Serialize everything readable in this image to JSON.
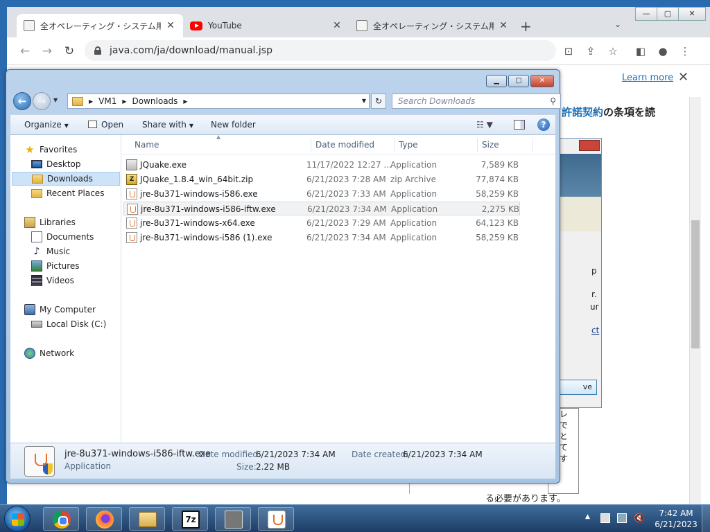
{
  "browser": {
    "tabs": [
      {
        "title": "全オペレーティング・システム用のJava",
        "favicon": "doc-icon"
      },
      {
        "title": "YouTube",
        "favicon": "youtube-icon"
      },
      {
        "title": "全オペレーティング・システム用のJava",
        "favicon": "doc-icon"
      }
    ],
    "url": "java.com/ja/download/manual.jsp",
    "learn_more": "Learn more",
    "page_heading_link": "許諾契約",
    "page_heading_rest": "の条項を読",
    "bg_dialog_fragments": [
      "p",
      "r.",
      "ur",
      "ct"
    ],
    "bg_dialog_button": "ve",
    "bg_text_fragments": [
      "レ",
      "で",
      "と",
      "て",
      "す"
    ],
    "bg_footer": "る必要があります。"
  },
  "explorer": {
    "breadcrumb": [
      "VM1",
      "Downloads"
    ],
    "search_placeholder": "Search Downloads",
    "commands": {
      "organize": "Organize",
      "open": "Open",
      "share_with": "Share with",
      "new_folder": "New folder"
    },
    "nav": {
      "favorites": "Favorites",
      "desktop": "Desktop",
      "downloads": "Downloads",
      "recent_places": "Recent Places",
      "libraries": "Libraries",
      "documents": "Documents",
      "music": "Music",
      "pictures": "Pictures",
      "videos": "Videos",
      "my_computer": "My Computer",
      "local_disk": "Local Disk (C:)",
      "network": "Network"
    },
    "columns": {
      "name": "Name",
      "date_modified": "Date modified",
      "type": "Type",
      "size": "Size"
    },
    "files": [
      {
        "name": "JQuake.exe",
        "date": "11/17/2022 12:27 ...",
        "type": "Application",
        "size": "7,589 KB",
        "icon": "jquake-icon"
      },
      {
        "name": "JQuake_1.8.4_win_64bit.zip",
        "date": "6/21/2023 7:28 AM",
        "type": "zip Archive",
        "size": "77,874 KB",
        "icon": "zip-icon"
      },
      {
        "name": "jre-8u371-windows-i586.exe",
        "date": "6/21/2023 7:33 AM",
        "type": "Application",
        "size": "58,259 KB",
        "icon": "java-installer-icon"
      },
      {
        "name": "jre-8u371-windows-i586-iftw.exe",
        "date": "6/21/2023 7:34 AM",
        "type": "Application",
        "size": "2,275 KB",
        "icon": "java-installer-icon"
      },
      {
        "name": "jre-8u371-windows-x64.exe",
        "date": "6/21/2023 7:29 AM",
        "type": "Application",
        "size": "64,123 KB",
        "icon": "java-installer-icon"
      },
      {
        "name": "jre-8u371-windows-i586 (1).exe",
        "date": "6/21/2023 7:34 AM",
        "type": "Application",
        "size": "58,259 KB",
        "icon": "java-installer-icon"
      }
    ],
    "details": {
      "name": "jre-8u371-windows-i586-iftw.exe",
      "type": "Application",
      "date_modified_label": "Date modified:",
      "date_modified": "6/21/2023 7:34 AM",
      "date_created_label": "Date created:",
      "date_created": "6/21/2023 7:34 AM",
      "size_label": "Size:",
      "size": "2.22 MB"
    }
  },
  "taskbar": {
    "apps": [
      "chrome",
      "firefox",
      "windows-explorer",
      "7-zip",
      "jquake",
      "java"
    ],
    "seven_zip_label": "7z",
    "time": "7:42 AM",
    "date": "6/21/2023"
  }
}
